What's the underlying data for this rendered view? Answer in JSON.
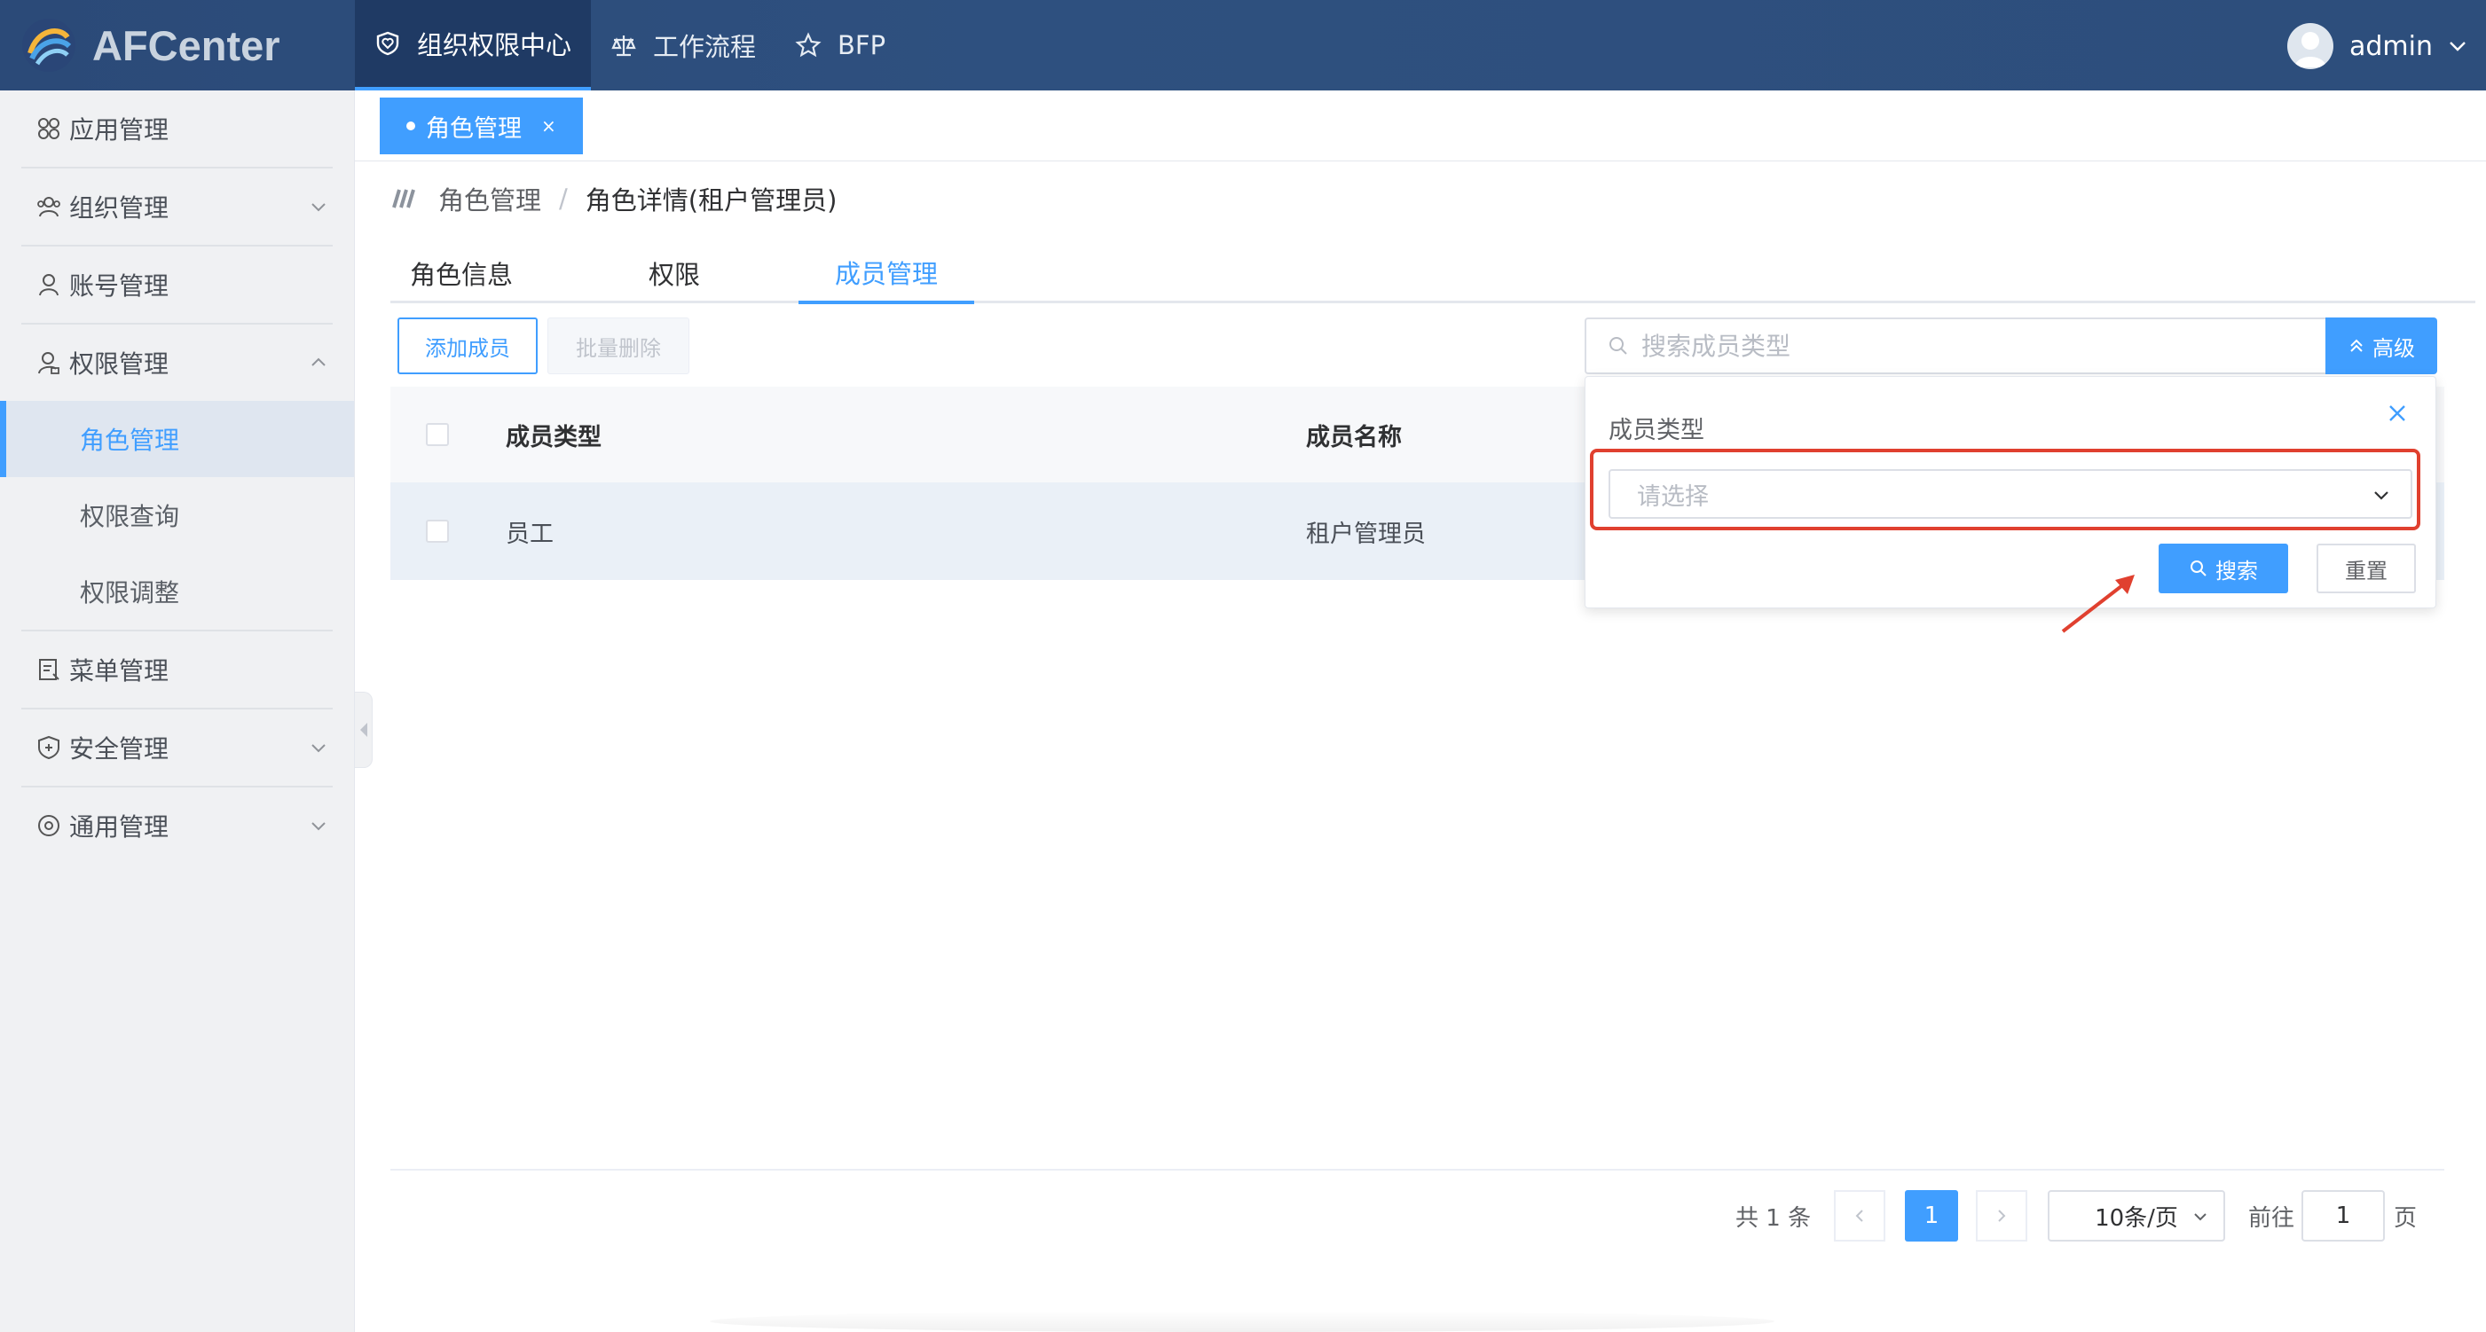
{
  "app": {
    "name": "AFCenter"
  },
  "topnav": [
    {
      "label": "组织权限中心",
      "icon": "shield-heart-icon",
      "active": true
    },
    {
      "label": "工作流程",
      "icon": "scale-icon",
      "active": false
    },
    {
      "label": "BFP",
      "icon": "star-icon",
      "active": false
    }
  ],
  "user": {
    "name": "admin"
  },
  "sidebar": {
    "items": [
      {
        "label": "应用管理",
        "icon": "grid-icon"
      },
      {
        "label": "组织管理",
        "icon": "group-icon"
      },
      {
        "label": "账号管理",
        "icon": "user-icon"
      },
      {
        "label": "权限管理",
        "icon": "user-key-icon"
      },
      {
        "label": "菜单管理",
        "icon": "menu-doc-icon"
      },
      {
        "label": "安全管理",
        "icon": "security-shield-icon"
      },
      {
        "label": "通用管理",
        "icon": "settings-icon"
      }
    ],
    "sub": [
      {
        "label": "角色管理",
        "active": true
      },
      {
        "label": "权限查询",
        "active": false
      },
      {
        "label": "权限调整",
        "active": false
      }
    ]
  },
  "tag": {
    "label": "角色管理",
    "close": "×"
  },
  "breadcrumb": {
    "parent": "角色管理",
    "sep": "/",
    "current": "角色详情(租户管理员)"
  },
  "tabs": [
    "角色信息",
    "权限",
    "成员管理"
  ],
  "toolbar": {
    "add": "添加成员",
    "batch_delete": "批量删除",
    "search_placeholder": "搜索成员类型",
    "advanced": "高级"
  },
  "table": {
    "headers": [
      "成员类型",
      "成员名称"
    ],
    "rows": [
      {
        "type": "员工",
        "name": "租户管理员"
      }
    ]
  },
  "popover": {
    "title": "成员类型",
    "select_placeholder": "请选择",
    "search": "搜索",
    "reset": "重置"
  },
  "pager": {
    "total": "共 1 条",
    "current": "1",
    "page_size": "10条/页",
    "goto": "前往",
    "goto_value": "1",
    "unit": "页"
  },
  "colors": {
    "primary": "#409eff",
    "topbar": "#2d4e7c",
    "highlight": "#e0402f"
  }
}
